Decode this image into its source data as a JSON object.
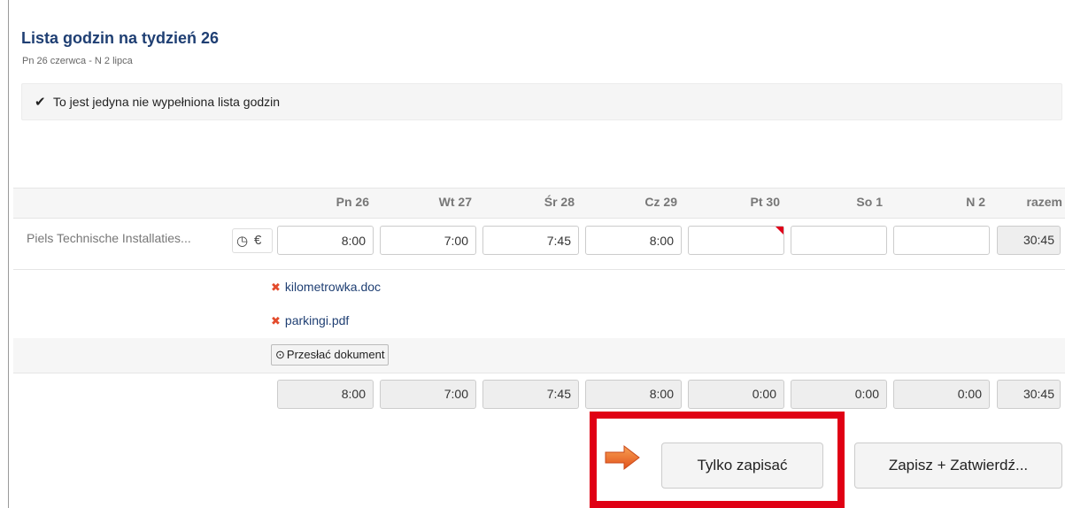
{
  "header": {
    "title": "Lista godzin na tydzień 26",
    "subtitle": "Pn 26 czerwca - N 2 lipca"
  },
  "notice": {
    "text": "To jest jedyna nie wypełniona lista godzin",
    "icon": "checkmark-icon"
  },
  "columns": {
    "days": [
      "Pn 26",
      "Wt 27",
      "Śr 28",
      "Cz 29",
      "Pt 30",
      "So 1",
      "N 2"
    ],
    "total": "razem"
  },
  "row": {
    "project": "Piels Technische Installaties...",
    "icons": [
      "clock-icon",
      "euro-icon"
    ],
    "hours": [
      "8:00",
      "7:00",
      "7:45",
      "8:00",
      "",
      "",
      ""
    ],
    "total": "30:45",
    "flagged_day": "Pt 30"
  },
  "documents": {
    "files": [
      {
        "name": "kilometrowka.doc"
      },
      {
        "name": "parkingi.pdf"
      }
    ],
    "upload_label": "Przesłać dokument"
  },
  "sums": {
    "days": [
      "8:00",
      "7:00",
      "7:45",
      "8:00",
      "0:00",
      "0:00",
      "0:00"
    ],
    "total": "30:45"
  },
  "actions": {
    "save_only": "Tylko zapisać",
    "save_approve": "Zapisz + Zatwierdź..."
  },
  "colors": {
    "title": "#1f3f73",
    "highlight_frame": "#e00014",
    "arrow": "#f26522",
    "delete_icon": "#e34b2c"
  }
}
